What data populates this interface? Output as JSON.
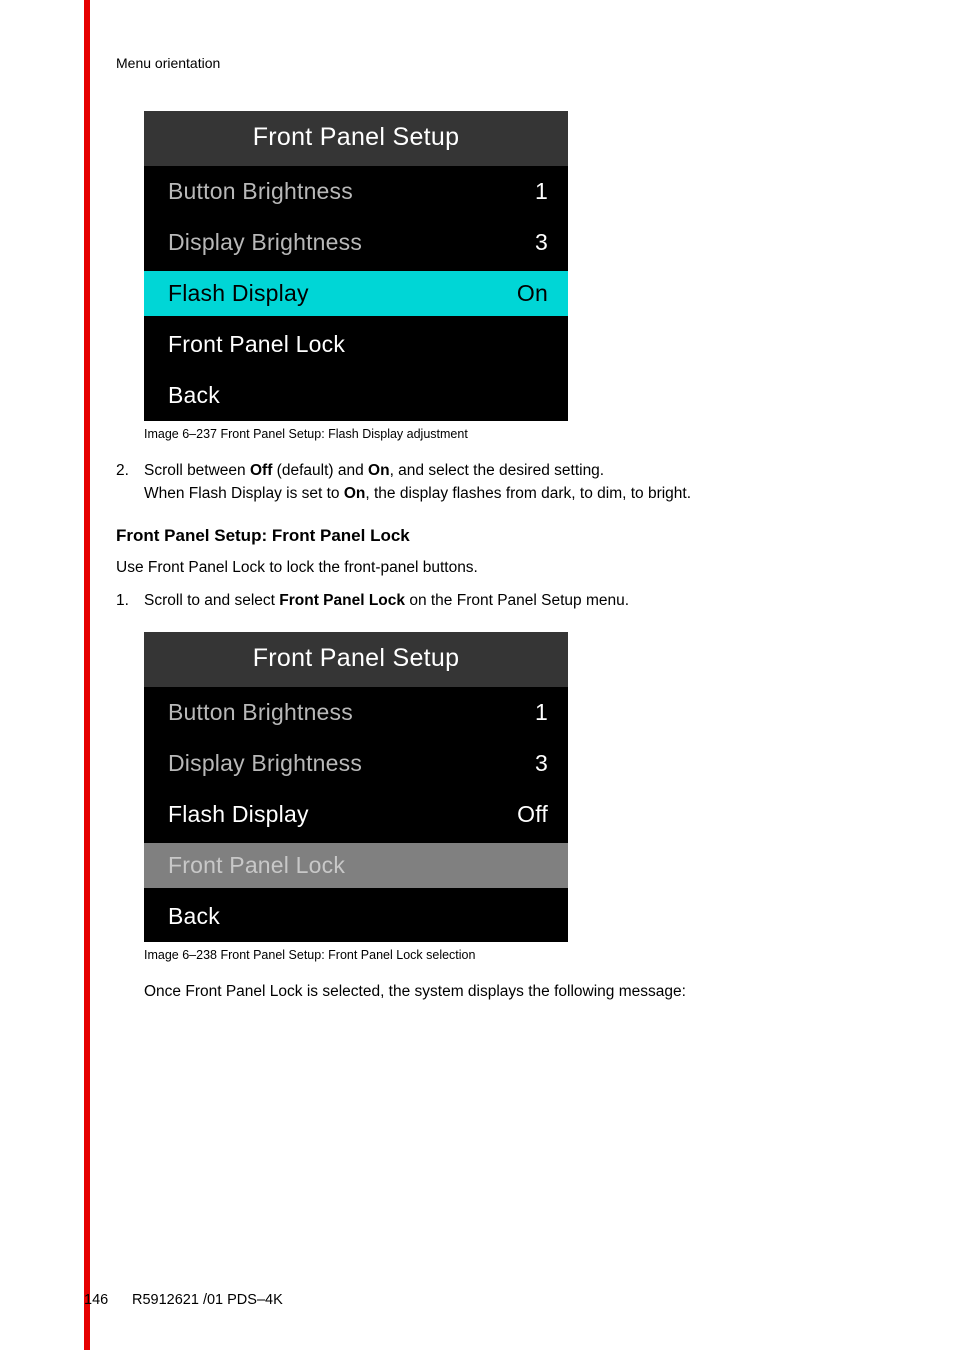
{
  "header": "Menu orientation",
  "menu1": {
    "title": "Front Panel Setup",
    "rows": [
      {
        "label": "Button Brightness",
        "value": "1"
      },
      {
        "label": "Display Brightness",
        "value": "3"
      },
      {
        "label": "Flash Display",
        "value": "On"
      },
      {
        "label": "Front Panel Lock",
        "value": ""
      },
      {
        "label": "Back",
        "value": ""
      }
    ]
  },
  "caption1": "Image 6–237  Front Panel Setup: Flash Display adjustment",
  "step2": {
    "num": "2.",
    "line1a": "Scroll between ",
    "off": "Off",
    "line1b": " (default) and ",
    "on1": "On",
    "line1c": ", and select the desired setting.",
    "line2a": "When Flash Display is set to ",
    "on2": "On",
    "line2b": ", the display flashes from dark, to dim, to bright."
  },
  "heading": "Front Panel Setup: Front Panel Lock",
  "para1": "Use Front Panel Lock to lock the front-panel buttons.",
  "step1": {
    "num": "1.",
    "a": "Scroll to and select ",
    "b": "Front Panel Lock",
    "c": " on the Front Panel Setup menu."
  },
  "menu2": {
    "title": "Front Panel Setup",
    "rows": [
      {
        "label": "Button Brightness",
        "value": "1"
      },
      {
        "label": "Display Brightness",
        "value": "3"
      },
      {
        "label": "Flash Display",
        "value": "Off"
      },
      {
        "label": "Front Panel Lock",
        "value": ""
      },
      {
        "label": "Back",
        "value": ""
      }
    ]
  },
  "caption2": "Image 6–238  Front Panel Setup: Front Panel Lock selection",
  "para2": "Once Front Panel Lock is selected, the system displays the following message:",
  "footer": {
    "page": "146",
    "doc": "R5912621 /01 PDS–4K"
  }
}
